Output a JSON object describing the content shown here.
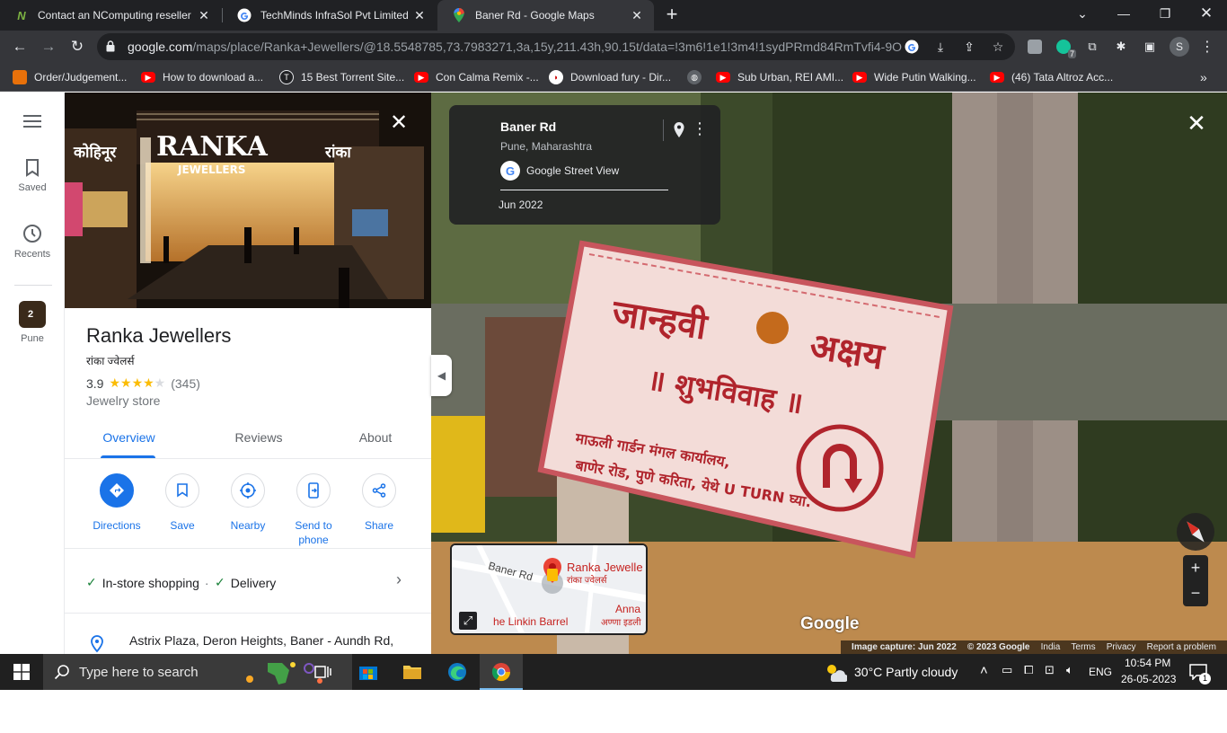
{
  "browser": {
    "tabs": [
      {
        "title": "Contact an NComputing reseller",
        "favicon": "ncomputing-icon",
        "active": false
      },
      {
        "title": "TechMinds InfraSol Pvt Limited -",
        "favicon": "google-icon",
        "active": false
      },
      {
        "title": "Baner Rd - Google Maps",
        "favicon": "maps-pin-icon",
        "active": true
      }
    ],
    "url_host": "google.com",
    "url_path": "/maps/place/Ranka+Jewellers/@18.5548785,73.7983271,3a,15y,211.43h,90.15t/data=!3m6!1e1!3m4!1sydPRmd84RmTvfi4-9O...",
    "profile_initial": "S",
    "extension_badge": "7",
    "bookmarks": [
      {
        "label": "Order/Judgement..."
      },
      {
        "label": "How to download a..."
      },
      {
        "label": "15 Best Torrent Site..."
      },
      {
        "label": "Con Calma Remix -..."
      },
      {
        "label": "Download fury - Dir..."
      },
      {
        "label": "Sub Urban, REI AMI..."
      },
      {
        "label": "Wide Putin Walking..."
      },
      {
        "label": "(46) Tata Altroz Acc..."
      }
    ]
  },
  "rail": {
    "saved": "Saved",
    "recents": "Recents",
    "pune": "Pune",
    "pune_badge": "2"
  },
  "place": {
    "name": "Ranka Jewellers",
    "alt_name": "रांका ज्वेलर्स",
    "rating": "3.9",
    "rating_value": 3.9,
    "reviews": "(345)",
    "category": "Jewelry store",
    "tabs": [
      "Overview",
      "Reviews",
      "About"
    ],
    "actions": [
      "Directions",
      "Save",
      "Nearby",
      "Send to phone",
      "Share"
    ],
    "features": [
      "In-store shopping",
      "Delivery"
    ],
    "feature_sep": "·",
    "address": "Astrix Plaza, Deron Heights, Baner - Aundh Rd,"
  },
  "streetview": {
    "title": "Baner Rd",
    "subtitle": "Pune, Maharashtra",
    "source": "Google Street View",
    "date": "Jun 2022",
    "minimap_labels": [
      "Baner Rd",
      "Ranka Jewelle",
      "रांका ज्वेलर्स",
      "he Linkin Barrel",
      "Anna",
      "अण्णा इडली"
    ],
    "google_logo": "Google",
    "attribution": [
      "Image capture: Jun 2022",
      "© 2023 Google",
      "India",
      "Terms",
      "Privacy",
      "Report a problem"
    ]
  },
  "taskbar": {
    "search_placeholder": "Type here to search",
    "weather": "30°C  Partly cloudy",
    "lang": "ENG",
    "time": "10:54 PM",
    "date": "26-05-2023",
    "notif_count": "1"
  },
  "colors": {
    "accent": "#1a73e8",
    "star": "#fbbc04",
    "check": "#188038"
  }
}
